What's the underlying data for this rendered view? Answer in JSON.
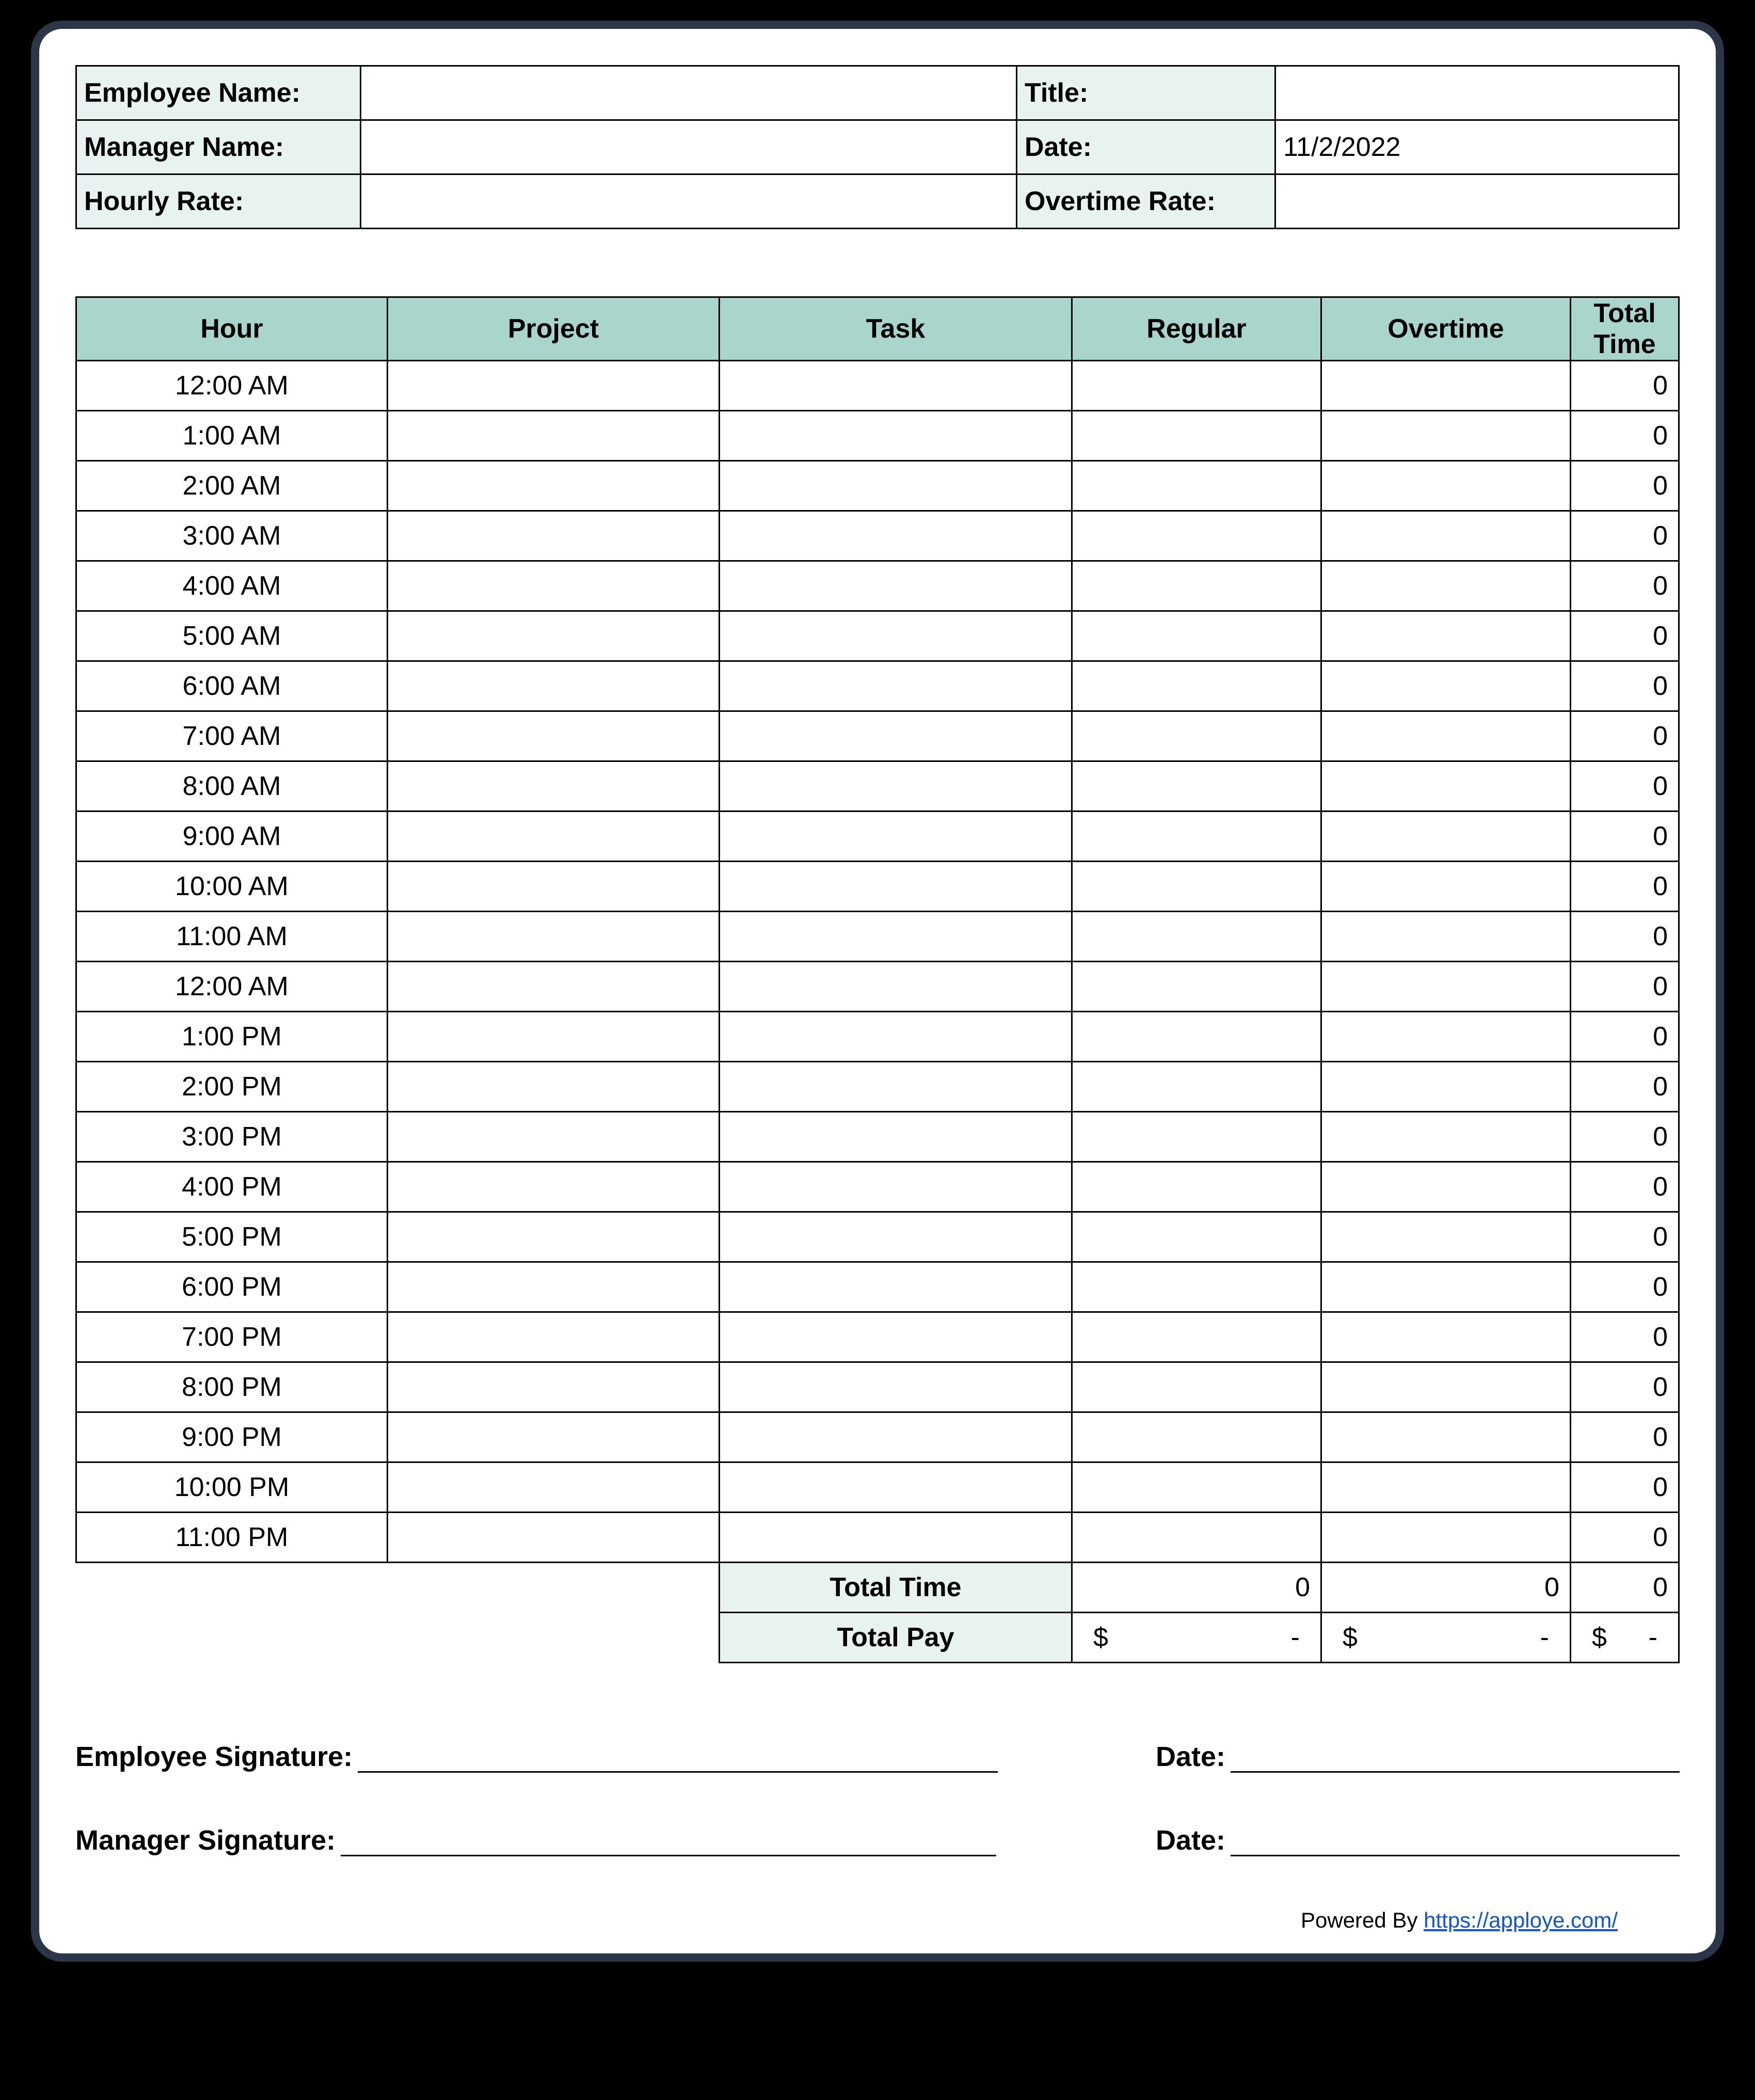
{
  "info": {
    "employee_name_label": "Employee Name:",
    "employee_name": "",
    "title_label": "Title:",
    "title": "",
    "manager_name_label": "Manager Name:",
    "manager_name": "",
    "date_label": "Date:",
    "date": "11/2/2022",
    "hourly_rate_label": "Hourly Rate:",
    "hourly_rate": "",
    "overtime_rate_label": "Overtime Rate:",
    "overtime_rate": ""
  },
  "log": {
    "headers": {
      "hour": "Hour",
      "project": "Project",
      "task": "Task",
      "regular": "Regular",
      "overtime": "Overtime",
      "total": "Total Time"
    },
    "rows": [
      {
        "hour": "12:00 AM",
        "project": "",
        "task": "",
        "regular": "",
        "overtime": "",
        "total": "0"
      },
      {
        "hour": "1:00 AM",
        "project": "",
        "task": "",
        "regular": "",
        "overtime": "",
        "total": "0"
      },
      {
        "hour": "2:00 AM",
        "project": "",
        "task": "",
        "regular": "",
        "overtime": "",
        "total": "0"
      },
      {
        "hour": "3:00 AM",
        "project": "",
        "task": "",
        "regular": "",
        "overtime": "",
        "total": "0"
      },
      {
        "hour": "4:00 AM",
        "project": "",
        "task": "",
        "regular": "",
        "overtime": "",
        "total": "0"
      },
      {
        "hour": "5:00 AM",
        "project": "",
        "task": "",
        "regular": "",
        "overtime": "",
        "total": "0"
      },
      {
        "hour": "6:00 AM",
        "project": "",
        "task": "",
        "regular": "",
        "overtime": "",
        "total": "0"
      },
      {
        "hour": "7:00 AM",
        "project": "",
        "task": "",
        "regular": "",
        "overtime": "",
        "total": "0"
      },
      {
        "hour": "8:00 AM",
        "project": "",
        "task": "",
        "regular": "",
        "overtime": "",
        "total": "0"
      },
      {
        "hour": "9:00 AM",
        "project": "",
        "task": "",
        "regular": "",
        "overtime": "",
        "total": "0"
      },
      {
        "hour": "10:00 AM",
        "project": "",
        "task": "",
        "regular": "",
        "overtime": "",
        "total": "0"
      },
      {
        "hour": "11:00 AM",
        "project": "",
        "task": "",
        "regular": "",
        "overtime": "",
        "total": "0"
      },
      {
        "hour": "12:00 AM",
        "project": "",
        "task": "",
        "regular": "",
        "overtime": "",
        "total": "0"
      },
      {
        "hour": "1:00 PM",
        "project": "",
        "task": "",
        "regular": "",
        "overtime": "",
        "total": "0"
      },
      {
        "hour": "2:00 PM",
        "project": "",
        "task": "",
        "regular": "",
        "overtime": "",
        "total": "0"
      },
      {
        "hour": "3:00 PM",
        "project": "",
        "task": "",
        "regular": "",
        "overtime": "",
        "total": "0"
      },
      {
        "hour": "4:00 PM",
        "project": "",
        "task": "",
        "regular": "",
        "overtime": "",
        "total": "0"
      },
      {
        "hour": "5:00 PM",
        "project": "",
        "task": "",
        "regular": "",
        "overtime": "",
        "total": "0"
      },
      {
        "hour": "6:00 PM",
        "project": "",
        "task": "",
        "regular": "",
        "overtime": "",
        "total": "0"
      },
      {
        "hour": "7:00 PM",
        "project": "",
        "task": "",
        "regular": "",
        "overtime": "",
        "total": "0"
      },
      {
        "hour": "8:00 PM",
        "project": "",
        "task": "",
        "regular": "",
        "overtime": "",
        "total": "0"
      },
      {
        "hour": "9:00 PM",
        "project": "",
        "task": "",
        "regular": "",
        "overtime": "",
        "total": "0"
      },
      {
        "hour": "10:00 PM",
        "project": "",
        "task": "",
        "regular": "",
        "overtime": "",
        "total": "0"
      },
      {
        "hour": "11:00 PM",
        "project": "",
        "task": "",
        "regular": "",
        "overtime": "",
        "total": "0"
      }
    ],
    "totals": {
      "label_time": "Total Time",
      "regular": "0",
      "overtime": "0",
      "total": "0",
      "label_pay": "Total Pay",
      "pay_regular_sym": "$",
      "pay_regular": "-",
      "pay_overtime_sym": "$",
      "pay_overtime": "-",
      "pay_total_sym": "$",
      "pay_total": "-"
    }
  },
  "signatures": {
    "employee": "Employee Signature:",
    "manager": "Manager Signature:",
    "date": "Date:"
  },
  "footer": {
    "powered": "Powered By ",
    "link_text": "https://apploye.com/",
    "link_href": "https://apploye.com/"
  }
}
